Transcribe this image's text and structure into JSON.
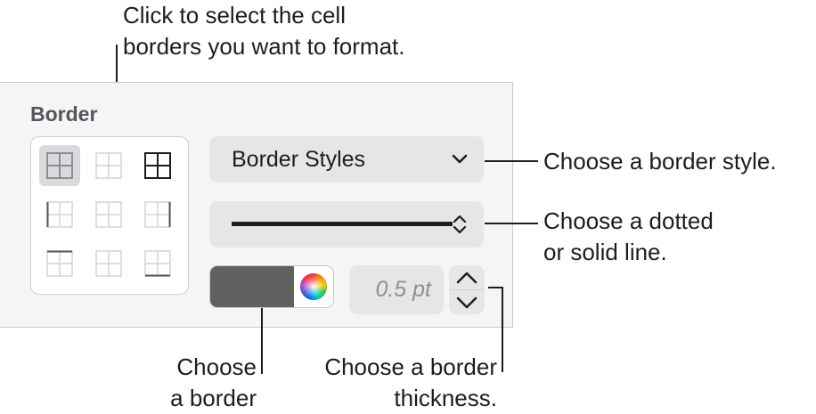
{
  "callouts": {
    "select_cells": [
      "Click to select the cell",
      "borders you want to format."
    ],
    "border_style": "Choose a border style.",
    "line_type": [
      "Choose a dotted",
      "or solid line."
    ],
    "border_color": [
      "Choose",
      "a border"
    ],
    "thickness": [
      "Choose a border",
      "thickness."
    ]
  },
  "panel": {
    "title": "Border",
    "border_grid": {
      "selected": "all-borders",
      "buttons": [
        "all-borders",
        "inside-borders",
        "outside-borders",
        "left-border",
        "vertical-inside",
        "right-border",
        "top-border",
        "horizontal-inside",
        "bottom-border"
      ]
    },
    "style_popup": {
      "label": "Border Styles",
      "icon": "chevron-down-icon"
    },
    "line_popup": {
      "value": "solid",
      "icon": "up-down-chevron-icon"
    },
    "color_well": {
      "color": "#606060",
      "icon": "color-wheel-icon"
    },
    "thickness": {
      "value": "0.5 pt",
      "up_icon": "chevron-up-icon",
      "down_icon": "chevron-down-icon"
    }
  }
}
